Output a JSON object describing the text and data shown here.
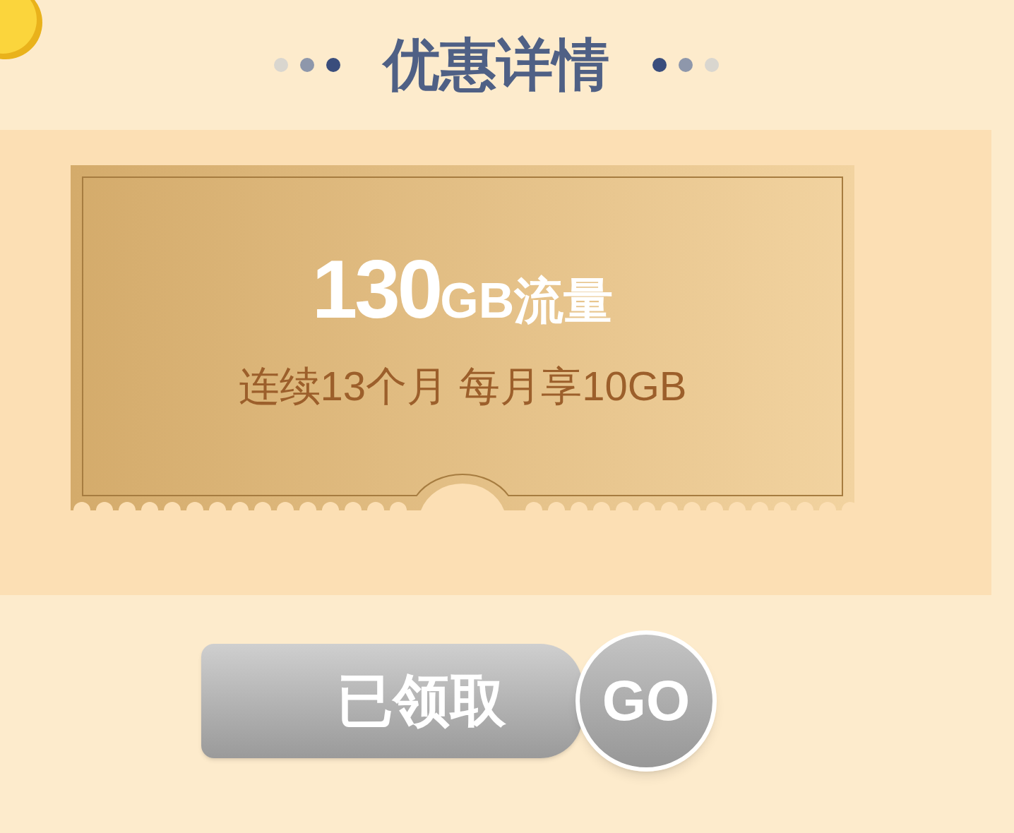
{
  "section_title": "优惠详情",
  "coupon": {
    "amount": "130",
    "unit": "GB流量",
    "description": "连续13个月 每月享10GB"
  },
  "claim_button": {
    "label": "已领取",
    "claimed": true,
    "go_label": "GO"
  }
}
